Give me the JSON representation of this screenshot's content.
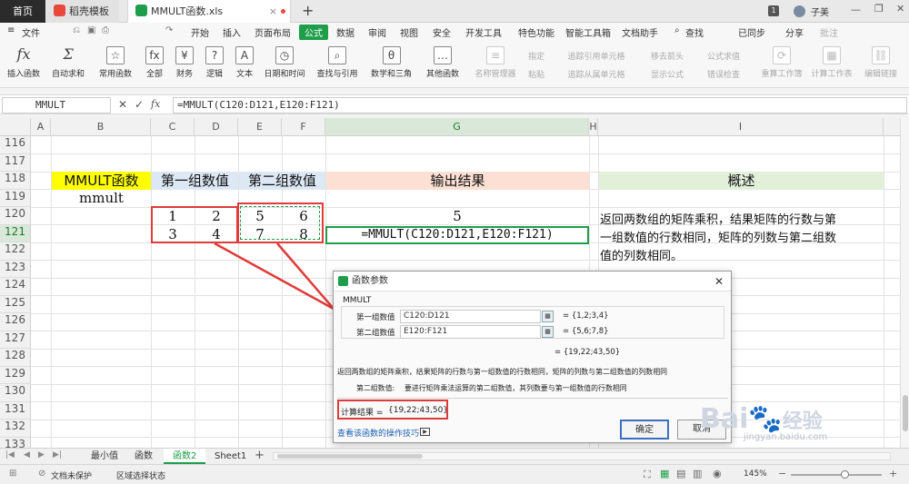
{
  "titlebar": {
    "home": "首页",
    "tab1": "稻壳模板",
    "tab2": "MMULT函数.xls",
    "add": "+",
    "page_num": "1",
    "user": "子美"
  },
  "menu": {
    "file": "文件",
    "items": [
      "开始",
      "插入",
      "页面布局",
      "公式",
      "数据",
      "审阅",
      "视图",
      "安全",
      "开发工具",
      "特色功能",
      "智能工具箱",
      "文档助手"
    ],
    "search": "查找",
    "sync": "已同步",
    "share": "分享",
    "comment": "批注"
  },
  "ribbon": {
    "buttons": [
      "插入函数",
      "自动求和",
      "常用函数",
      "全部",
      "财务",
      "逻辑",
      "文本",
      "日期和时间",
      "查找与引用",
      "数学和三角",
      "其他函数",
      "名称管理器",
      "粘贴",
      "指定",
      "追踪引用单元格",
      "追踪从属单元格",
      "移去箭头",
      "显示公式",
      "公式求值",
      "错误检查",
      "重算工作簿",
      "计算工作表",
      "编辑链接"
    ]
  },
  "formula_bar": {
    "name_box": "MMULT",
    "formula": "=MMULT(C120:D121,E120:F121)"
  },
  "sheet": {
    "columns": [
      "A",
      "B",
      "C",
      "D",
      "E",
      "F",
      "G",
      "H",
      "I"
    ],
    "rows": [
      "116",
      "117",
      "118",
      "119",
      "120",
      "121",
      "122",
      "123",
      "124",
      "125",
      "126",
      "127",
      "128",
      "129",
      "130",
      "131",
      "132",
      "133"
    ],
    "headers": {
      "b": "MMULT函数",
      "cd": "第一组数值",
      "ef": "第二组数值",
      "g": "输出结果",
      "i": "概述"
    },
    "b119": "mmult",
    "c120": "1",
    "d120": "2",
    "e120": "5",
    "f120": "6",
    "c121": "3",
    "d121": "4",
    "e121": "7",
    "f121": "8",
    "g120": "5",
    "g121": "=MMULT(C120:D121,E120:F121)",
    "i120": "返回两数组的矩阵乘积，结果矩阵的行数与第",
    "i121": "一组数值的行数相同，矩阵的列数与第二组数",
    "i122": "值的列数相同。"
  },
  "dialog": {
    "title": "函数参数",
    "func": "MMULT",
    "arg1_label": "第一组数值",
    "arg1_value": "C120:D121",
    "arg1_result": "= {1,2;3,4}",
    "arg2_label": "第二组数值",
    "arg2_value": "E120:F121",
    "arg2_result": "= {5,6;7,8}",
    "result_line": "= {19,22;43,50}",
    "desc": "返回两数组的矩阵乘积，结果矩阵的行数与第一组数值的行数相同，矩阵的列数与第二组数值的列数相同",
    "arg_desc_label": "第二组数值:",
    "arg_desc": "要进行矩阵乘法运算的第二组数值，其列数要与第一组数值的行数相同",
    "calc_label": "计算结果 =",
    "calc_value": "{19,22;43,50}",
    "help_link": "查看该函数的操作技巧",
    "ok": "确定",
    "cancel": "取消"
  },
  "sheet_tabs": [
    "最小值",
    "函数",
    "函数2",
    "Sheet1"
  ],
  "active_sheet": "函数2",
  "status": {
    "protect": "文档未保护",
    "selection": "区域选择状态",
    "zoom": "145%"
  },
  "watermark": {
    "brand": "Bai",
    "brand2": "经验",
    "url": "jingyan.baidu.com"
  },
  "colors": {
    "accent": "#1e9e4a",
    "header_yellow": "#ffff00",
    "header_blue": "#dde8f5",
    "header_peach": "#fde0d4",
    "header_green": "#e2efd9",
    "highlight_red": "#e03a3a"
  }
}
